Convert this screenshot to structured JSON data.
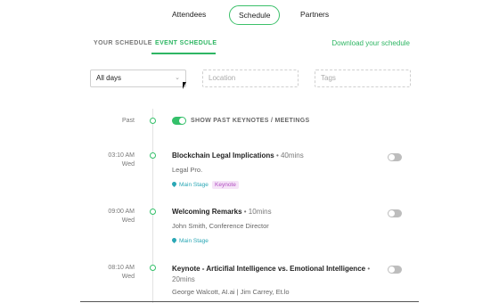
{
  "nav": {
    "attendees": "Attendees",
    "schedule": "Schedule",
    "partners": "Partners"
  },
  "subtabs": {
    "your": "YOUR SCHEDULE",
    "event": "EVENT SCHEDULE",
    "download": "Download your schedule"
  },
  "filters": {
    "days_value": "All days",
    "location_placeholder": "Location",
    "tags_placeholder": "Tags"
  },
  "past": {
    "label": "Past",
    "toggle_label": "SHOW PAST KEYNOTES / MEETINGS"
  },
  "events": [
    {
      "time": "03:10 AM",
      "day": "Wed",
      "title": "Blockchain Legal Implications",
      "duration": "• 40mins",
      "sub": "Legal Pro.",
      "location": "Main Stage",
      "tag": "Keynote"
    },
    {
      "time": "09:00 AM",
      "day": "Wed",
      "title": "Welcoming Remarks",
      "duration": "• 10mins",
      "sub": "John Smith, Conference Director",
      "location": "Main Stage"
    },
    {
      "time": "08:10 AM",
      "day": "Wed",
      "title": "Keynote - Articifial Intelligence vs. Emotional Intelligence",
      "duration": "•",
      "duration2": "20mins",
      "sub": "George Walcott, AI.ai | Jim Carrey, Et.lo"
    }
  ],
  "colors": {
    "accent": "#34c06a",
    "location": "#2aa7b5",
    "tag": "#b04fc0"
  }
}
